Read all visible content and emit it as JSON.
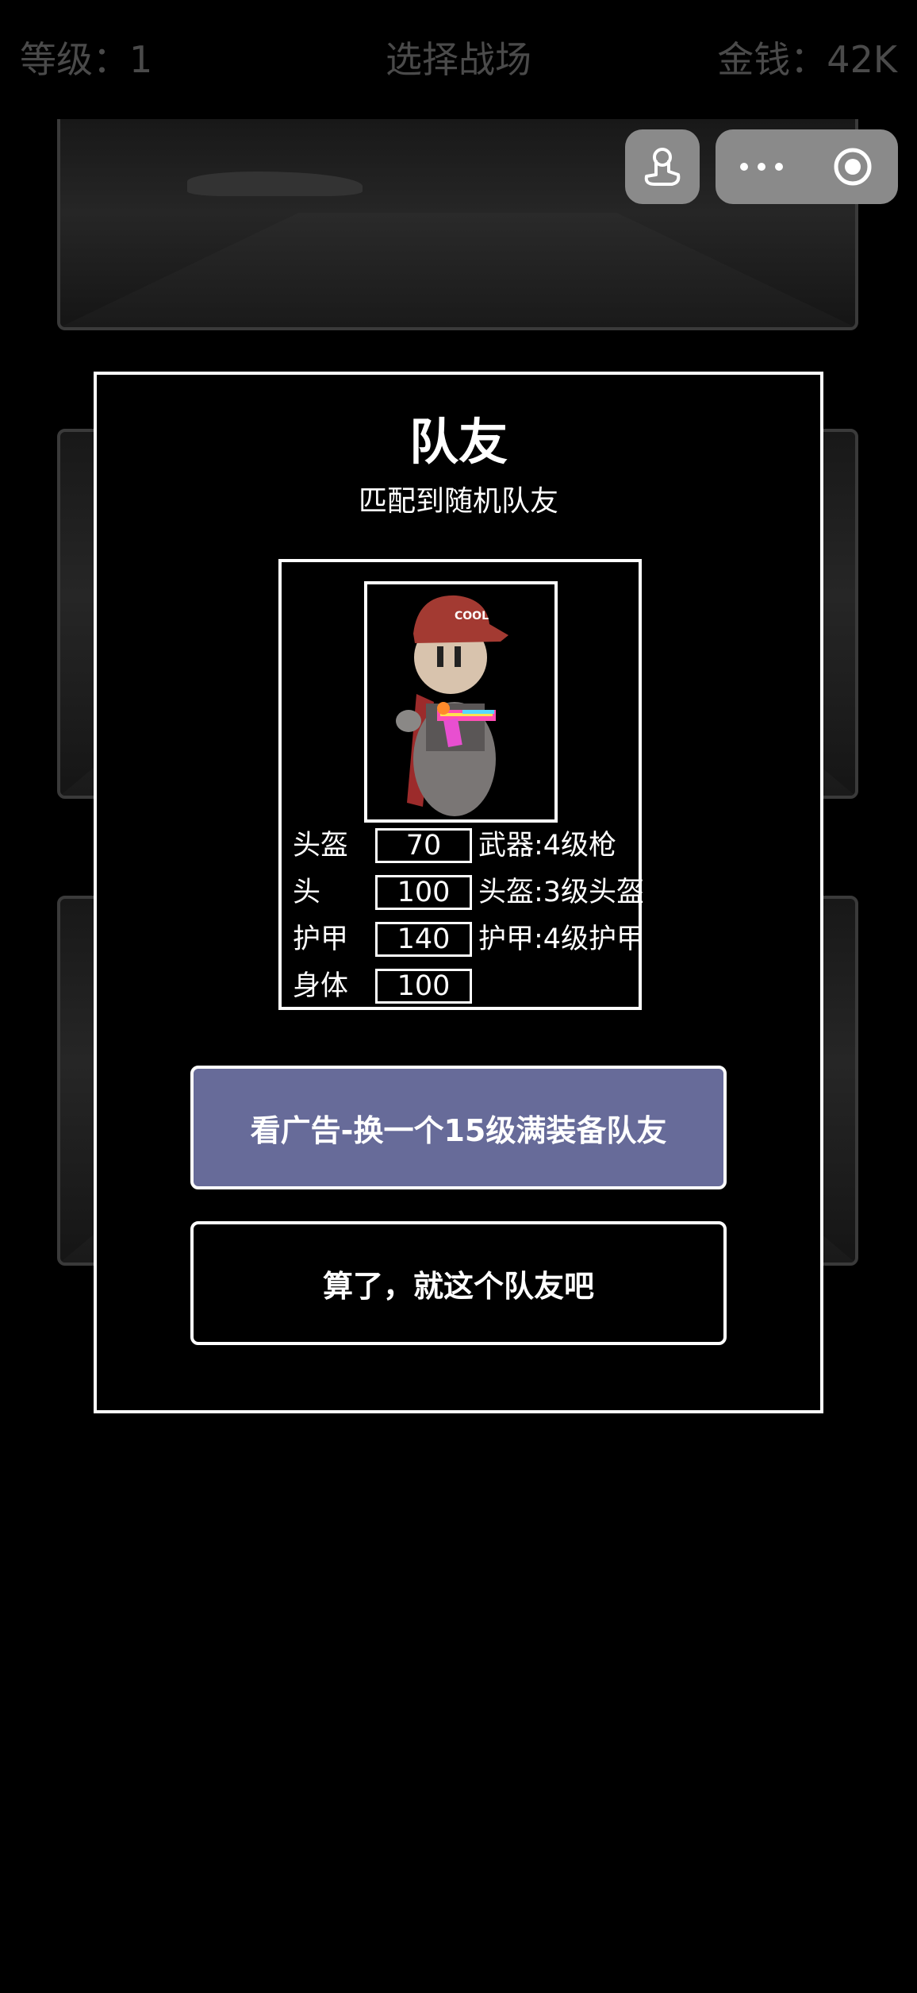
{
  "header": {
    "level": "等级：1",
    "title": "选择战场",
    "money": "金钱：42K"
  },
  "modal": {
    "title": "队友",
    "subtitle": "匹配到随机队友",
    "stats": [
      {
        "label": "头盔",
        "value": "70",
        "equip": "武器:4级枪"
      },
      {
        "label": "头",
        "value": "100",
        "equip": "头盔:3级头盔"
      },
      {
        "label": "护甲",
        "value": "140",
        "equip": "护甲:4级护甲"
      },
      {
        "label": "身体",
        "value": "100",
        "equip": ""
      }
    ],
    "buttons": {
      "ad_label": "看广告-换一个15级满装备队友",
      "accept_label": "算了，就这个队友吧"
    }
  },
  "icons": {
    "mini_program": "touch-pointer-icon",
    "more": "more-dots-icon",
    "close": "target-close-icon"
  },
  "colors": {
    "ad_button": "#676b99",
    "header_text": "#4a4a4a",
    "capsule": "#8a8a8a"
  }
}
